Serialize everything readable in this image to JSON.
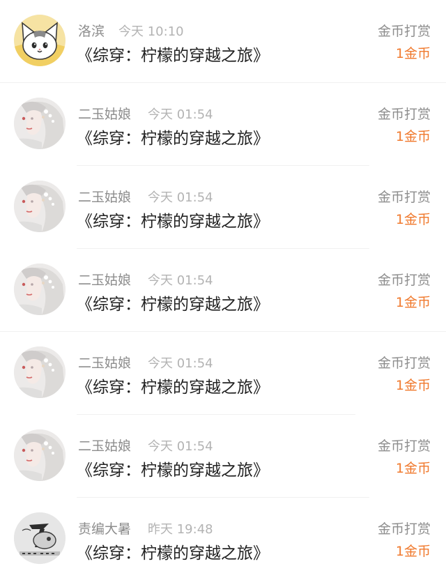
{
  "records": [
    {
      "user": "洛滨",
      "time": "今天 10:10",
      "title": "《综穿：柠檬的穿越之旅》",
      "type": "金币打赏",
      "amount": "1金币",
      "avatar_icon": "cartoon-cat-avatar-icon"
    },
    {
      "user": "二玉姑娘",
      "time": "今天 01:54",
      "title": "《综穿：柠檬的穿越之旅》",
      "type": "金币打赏",
      "amount": "1金币",
      "avatar_icon": "anime-girl-avatar-icon"
    },
    {
      "user": "二玉姑娘",
      "time": "今天 01:54",
      "title": "《综穿：柠檬的穿越之旅》",
      "type": "金币打赏",
      "amount": "1金币",
      "avatar_icon": "anime-girl-avatar-icon"
    },
    {
      "user": "二玉姑娘",
      "time": "今天 01:54",
      "title": "《综穿：柠檬的穿越之旅》",
      "type": "金币打赏",
      "amount": "1金币",
      "avatar_icon": "anime-girl-avatar-icon"
    },
    {
      "user": "二玉姑娘",
      "time": "今天 01:54",
      "title": "《综穿：柠檬的穿越之旅》",
      "type": "金币打赏",
      "amount": "1金币",
      "avatar_icon": "anime-girl-avatar-icon"
    },
    {
      "user": "二玉姑娘",
      "time": "今天 01:54",
      "title": "《综穿：柠檬的穿越之旅》",
      "type": "金币打赏",
      "amount": "1金币",
      "avatar_icon": "anime-girl-avatar-icon"
    },
    {
      "user": "责编大暑",
      "time": "昨天 19:48",
      "title": "《综穿：柠檬的穿越之旅》",
      "type": "金币打赏",
      "amount": "1金币",
      "avatar_icon": "grey-sketch-logo-avatar-icon"
    }
  ],
  "colors": {
    "amount": "#f0792d",
    "meta_text": "#8d8d8d",
    "time_text": "#b3b3b3",
    "title_text": "#222222",
    "divider": "#f0f0f0"
  }
}
